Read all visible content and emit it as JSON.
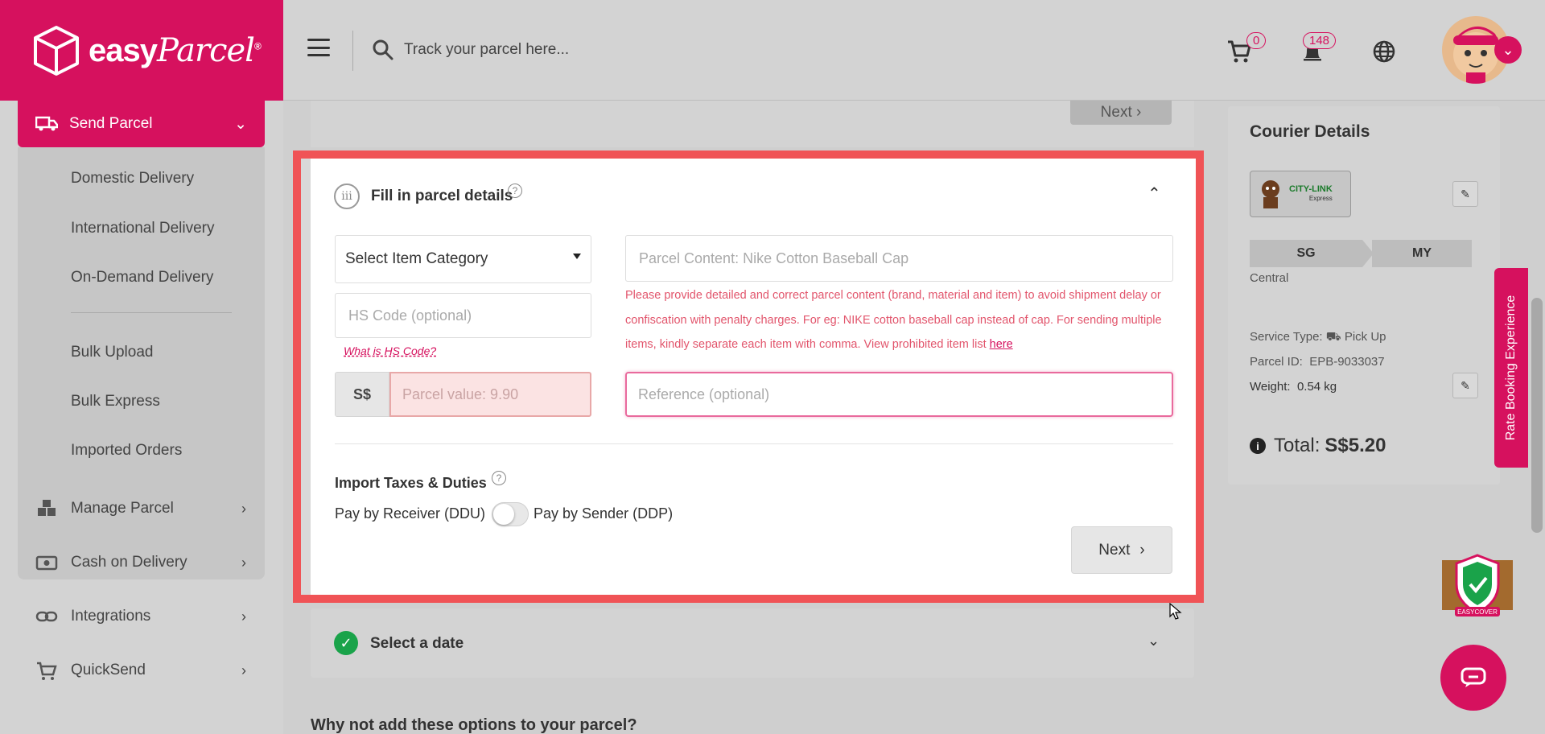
{
  "brand": {
    "name_bold": "easy",
    "name_script": "Parcel",
    "trademark": "®",
    "accent": "#d6115e"
  },
  "header": {
    "search_placeholder": "Track your parcel here...",
    "cart_count": "0",
    "notification_count": "148"
  },
  "sidebar": {
    "send_parcel": "Send Parcel",
    "submenu": [
      "Domestic Delivery",
      "International Delivery",
      "On-Demand Delivery",
      "Bulk Upload",
      "Bulk Express",
      "Imported Orders"
    ],
    "nav": [
      "Manage Parcel",
      "Cash on Delivery",
      "Integrations",
      "QuickSend"
    ]
  },
  "top_card": {
    "next_label": "Next"
  },
  "parcel_step": {
    "step_number": "iii",
    "title": "Fill in parcel details",
    "help": "?",
    "category_select": "Select Item Category",
    "hs_placeholder": "HS Code (optional)",
    "hs_link": "What is HS Code?",
    "currency": "S$",
    "value_placeholder": "Parcel value: 9.90",
    "content_placeholder": "Parcel Content: Nike Cotton Baseball Cap",
    "warning": "Please provide detailed and correct parcel content (brand, material and item) to avoid shipment delay or confiscation with penalty charges. For eg: NIKE cotton baseball cap instead of cap. For sending multiple items, kindly separate each item with comma. View prohibited item list ",
    "warning_link": "here",
    "reference_placeholder": "Reference (optional)",
    "taxes_title": "Import Taxes & Duties",
    "ddu_label": "Pay by Receiver (DDU)",
    "ddp_label": "Pay by Sender (DDP)",
    "next_label": "Next"
  },
  "date_step": {
    "title": "Select a date"
  },
  "options_heading": "Why not add these options to your parcel?",
  "courier": {
    "title": "Courier Details",
    "logo_text": "CITY-LINK",
    "logo_sub": "Express",
    "from": "SG",
    "to": "MY",
    "region": "Central",
    "service_label": "Service Type:",
    "service_value": "Pick Up",
    "parcel_id_label": "Parcel ID:",
    "parcel_id": "EPB-9033037",
    "weight_label": "Weight:",
    "weight": "0.54 kg",
    "total_label": "Total:",
    "total": "S$5.20"
  },
  "rate_tab": "Rate Booking Experience",
  "easycover": "EASYCOVER"
}
